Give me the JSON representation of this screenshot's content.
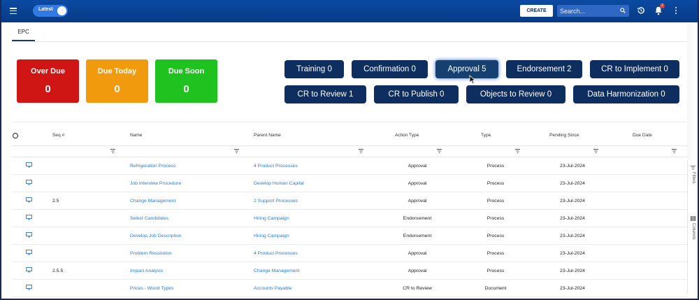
{
  "topbar": {
    "toggle_label": "Latest",
    "create_label": "CREATE",
    "search_placeholder": "Search...",
    "notification_count": "2",
    "accent": "#0a4595"
  },
  "tabs": [
    {
      "label": "EPC"
    }
  ],
  "status_cards": [
    {
      "title": "Over Due",
      "count": "0",
      "color": "#d01515"
    },
    {
      "title": "Due Today",
      "count": "0",
      "color": "#f29a0d"
    },
    {
      "title": "Due Soon",
      "count": "0",
      "color": "#1fc21f"
    }
  ],
  "queues": [
    {
      "label": "Training 0"
    },
    {
      "label": "Confirmation 0"
    },
    {
      "label": "Approval 5"
    },
    {
      "label": "Endorsement 2"
    },
    {
      "label": "CR to Implement 0"
    },
    {
      "label": "CR to Review 1"
    },
    {
      "label": "CR to Publish 0"
    },
    {
      "label": "Objects to Review 0"
    },
    {
      "label": "Data Harmonization 0"
    }
  ],
  "table": {
    "columns": [
      "Seq #",
      "Name",
      "Parent Name",
      "Action Type",
      "Type",
      "Pending Since",
      "Due Date"
    ],
    "rows": [
      {
        "seq": "",
        "name": "Refrigeration Process",
        "parent": "4 Product Processes",
        "action": "Approval",
        "type": "Process",
        "pending": "23-Jul-2024",
        "due": ""
      },
      {
        "seq": "",
        "name": "Job Interview Procedure",
        "parent": "Develop Human Capital",
        "action": "Approval",
        "type": "Process",
        "pending": "23-Jul-2024",
        "due": ""
      },
      {
        "seq": "2.5",
        "name": "Change Management",
        "parent": "2 Support Processes",
        "action": "Approval",
        "type": "Process",
        "pending": "23-Jul-2024",
        "due": ""
      },
      {
        "seq": "",
        "name": "Select Candidates",
        "parent": "Hiring Campaign",
        "action": "Endorsement",
        "type": "Process",
        "pending": "23-Jul-2024",
        "due": ""
      },
      {
        "seq": "",
        "name": "Develop Job Description",
        "parent": "Hiring Campaign",
        "action": "Endorsement",
        "type": "Process",
        "pending": "23-Jul-2024",
        "due": ""
      },
      {
        "seq": "",
        "name": "Problem Resolution",
        "parent": "4 Product Processes",
        "action": "Approval",
        "type": "Process",
        "pending": "23-Jul-2024",
        "due": ""
      },
      {
        "seq": "2.5.5",
        "name": "Impact Analysis",
        "parent": "Change Management",
        "action": "Approval",
        "type": "Process",
        "pending": "23-Jul-2024",
        "due": ""
      },
      {
        "seq": "",
        "name": "Prices - Wood Types",
        "parent": "Accounts Payable",
        "action": "CR to Review",
        "type": "Document",
        "pending": "23-Jul-2024",
        "due": ""
      }
    ]
  },
  "side_panel": {
    "filters_label": "Filters",
    "columns_label": "Columns"
  }
}
